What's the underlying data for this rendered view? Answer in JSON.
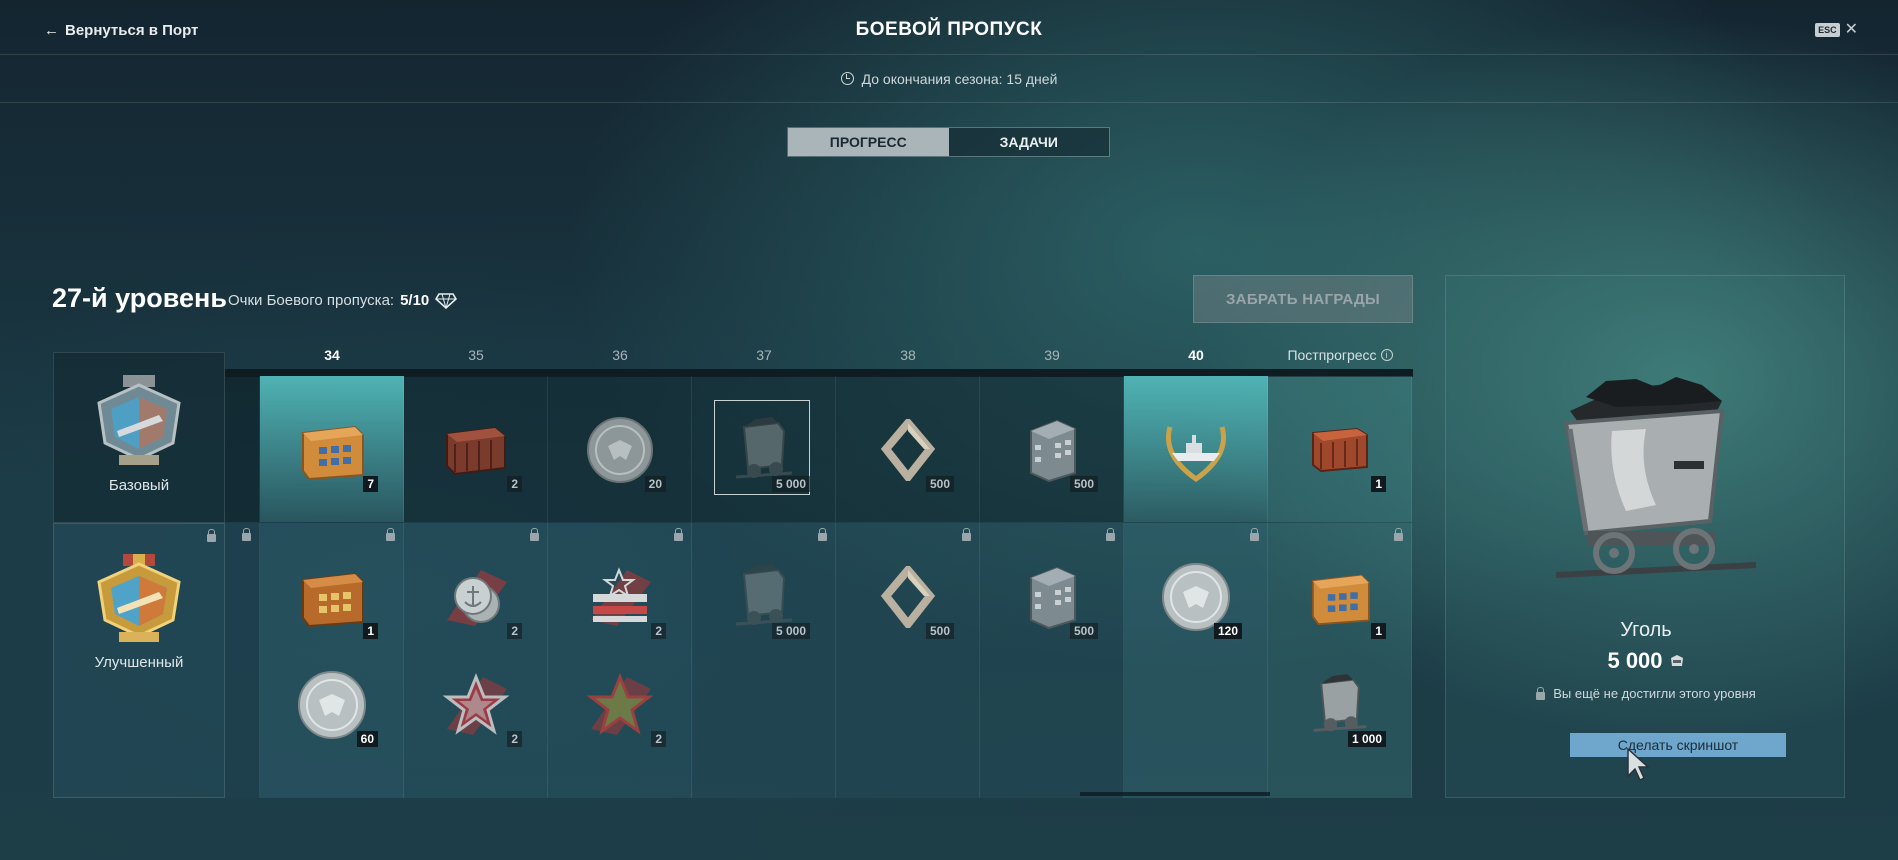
{
  "header": {
    "back_label": "Вернуться в Порт",
    "title": "БОЕВОЙ ПРОПУСК",
    "esc_label": "ESC",
    "season_remaining": "До окончания сезона: 15 дней"
  },
  "tabs": [
    {
      "label": "ПРОГРЕСС",
      "active": true
    },
    {
      "label": "ЗАДАЧИ",
      "active": false
    }
  ],
  "progress": {
    "level_title": "27-й уровень",
    "points_label": "Очки Боевого пропуска:",
    "points_value": "5/10",
    "claim_button": "ЗАБРАТЬ НАГРАДЫ"
  },
  "tiers": {
    "base_label": "Базовый",
    "premium_label": "Улучшенный"
  },
  "levels": [
    "34",
    "35",
    "36",
    "37",
    "38",
    "39",
    "40"
  ],
  "post_progress_label": "Постпрогресс",
  "rewards": {
    "base": [
      {
        "icon": "container-icon",
        "count": "7"
      },
      {
        "icon": "crate-icon",
        "count": "2"
      },
      {
        "icon": "coin-icon",
        "count": "20"
      },
      {
        "icon": "coal-cart-icon",
        "count": "5 000"
      },
      {
        "icon": "steel-icon",
        "count": "500"
      },
      {
        "icon": "building-icon",
        "count": "500"
      },
      {
        "icon": "ship-laurel-icon",
        "count": ""
      },
      {
        "icon": "crate-icon",
        "count": "1"
      }
    ],
    "premium_top": [
      {
        "icon": "container-icon",
        "count": "1"
      },
      {
        "icon": "anchor-coins-icon",
        "count": "2"
      },
      {
        "icon": "star-flag-icon",
        "count": "2"
      },
      {
        "icon": "coal-cart-icon",
        "count": "5 000"
      },
      {
        "icon": "steel-icon",
        "count": "500"
      },
      {
        "icon": "building-icon",
        "count": "500"
      },
      {
        "icon": "coin-icon",
        "count": "120"
      },
      {
        "icon": "container-icon",
        "count": "1"
      }
    ],
    "premium_bottom": [
      {
        "icon": "coin-icon",
        "count": "60"
      },
      {
        "icon": "red-star-icon",
        "count": "2"
      },
      {
        "icon": "green-star-icon",
        "count": "2"
      },
      {
        "icon": "coal-cart-icon",
        "count": "1 000"
      }
    ]
  },
  "detail": {
    "name": "Уголь",
    "amount": "5 000",
    "locked_text": "Вы ещё не достигли этого уровня",
    "screenshot_button": "Сделать скриншот"
  },
  "colors": {
    "highlight_column": "#4fb3b4",
    "tab_active": "#a9b5b9",
    "screenshot_button": "#6ea6cc"
  }
}
